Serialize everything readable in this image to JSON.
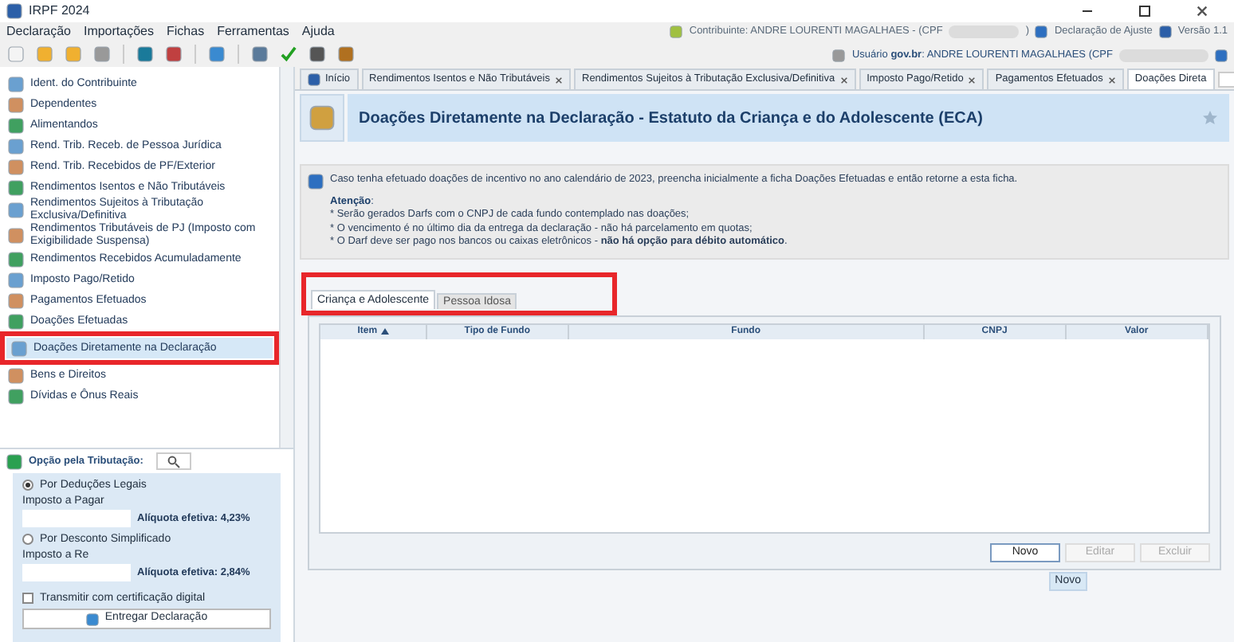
{
  "window": {
    "title": "IRPF 2024"
  },
  "menu": [
    "Declaração",
    "Importações",
    "Fichas",
    "Ferramentas",
    "Ajuda"
  ],
  "header": {
    "contribuinte": "Contribuinte: ANDRE LOURENTI MAGALHAES - (CPF",
    "contribuinte_end": ")",
    "declaracao": "Declaração de Ajuste",
    "versao": "Versão 1.1",
    "usuario": "Usuário **gov.br**: ANDRE LOURENTI MAGALHAES (CPF"
  },
  "sidebar": {
    "items": [
      {
        "label": "Ident. do Contribuinte",
        "selected": false
      },
      {
        "label": "Dependentes",
        "selected": false
      },
      {
        "label": "Alimentandos",
        "selected": false
      },
      {
        "label": "Rend. Trib. Receb. de Pessoa Jurídica",
        "selected": false
      },
      {
        "label": "Rend. Trib. Recebidos de PF/Exterior",
        "selected": false
      },
      {
        "label": "Rendimentos Isentos e Não Tributáveis",
        "selected": false
      },
      {
        "label": "Rendimentos Sujeitos à Tributação Exclusiva/Definitiva",
        "selected": false
      },
      {
        "label": "Rendimentos Tributáveis de PJ (Imposto com Exigibilidade Suspensa)",
        "selected": false
      },
      {
        "label": "Rendimentos Recebidos Acumuladamente",
        "selected": false
      },
      {
        "label": "Imposto Pago/Retido",
        "selected": false
      },
      {
        "label": "Pagamentos Efetuados",
        "selected": false
      },
      {
        "label": "Doações Efetuadas",
        "selected": false
      },
      {
        "label": "Doações Diretamente na Declaração",
        "selected": true
      },
      {
        "label": "Bens e Direitos",
        "selected": false
      },
      {
        "label": "Dívidas e Ônus Reais",
        "selected": false
      }
    ]
  },
  "tributacao": {
    "label": "Opção pela Tributação:",
    "options": [
      {
        "label": "Por Deduções Legais",
        "selected": true,
        "field_label": "Imposto a Pagar",
        "aliquota": "Alíquota efetiva: 4,23%"
      },
      {
        "label": "Por Desconto Simplificado",
        "selected": false,
        "field_label": "Imposto a Re",
        "aliquota": "Alíquota efetiva: 2,84%"
      }
    ],
    "certificado": {
      "label": "Transmitir com certificação digital",
      "checked": false
    },
    "entregar": "Entregar Declaração"
  },
  "tabs": [
    {
      "label": "Início",
      "selected": false,
      "closable": false
    },
    {
      "label": "Rendimentos Isentos e Não Tributáveis",
      "selected": false,
      "closable": true
    },
    {
      "label": "Rendimentos Sujeitos à Tributação Exclusiva/Definitiva",
      "selected": false,
      "closable": true
    },
    {
      "label": "Imposto Pago/Retido",
      "selected": false,
      "closable": true
    },
    {
      "label": "Pagamentos Efetuados",
      "selected": false,
      "closable": true
    },
    {
      "label": "Doações Direta",
      "selected": true,
      "closable": false
    }
  ],
  "page": {
    "title": "Doações Diretamente na Declaração - Estatuto da Criança e do Adolescente (ECA)",
    "info": "Caso tenha efetuado doações de incentivo no ano calendário de 2023, preencha inicialmente a ficha Doações Efetuadas e então retorne a esta ficha.",
    "atencao": "**Atenção**:",
    "notes": [
      "* Serão gerados Darfs com o CNPJ de cada fundo contemplado nas doações;",
      "* O vencimento é no último dia da entrega da declaração - não há parcelamento em quotas;",
      "* O Darf deve ser pago nos bancos ou caixas eletrônicos - **não há opção para débito automático**."
    ],
    "inner_tabs": [
      {
        "label": "Criança e Adolescente",
        "selected": true
      },
      {
        "label": "Pessoa Idosa",
        "selected": false
      }
    ],
    "table": {
      "columns": [
        "Item",
        "Tipo de Fundo",
        "Fundo",
        "CNPJ",
        "Valor"
      ]
    },
    "buttons": [
      {
        "label": "Novo",
        "disabled": false
      },
      {
        "label": "Editar",
        "disabled": true
      },
      {
        "label": "Excluir",
        "disabled": true
      }
    ],
    "tooltip": "Novo"
  }
}
